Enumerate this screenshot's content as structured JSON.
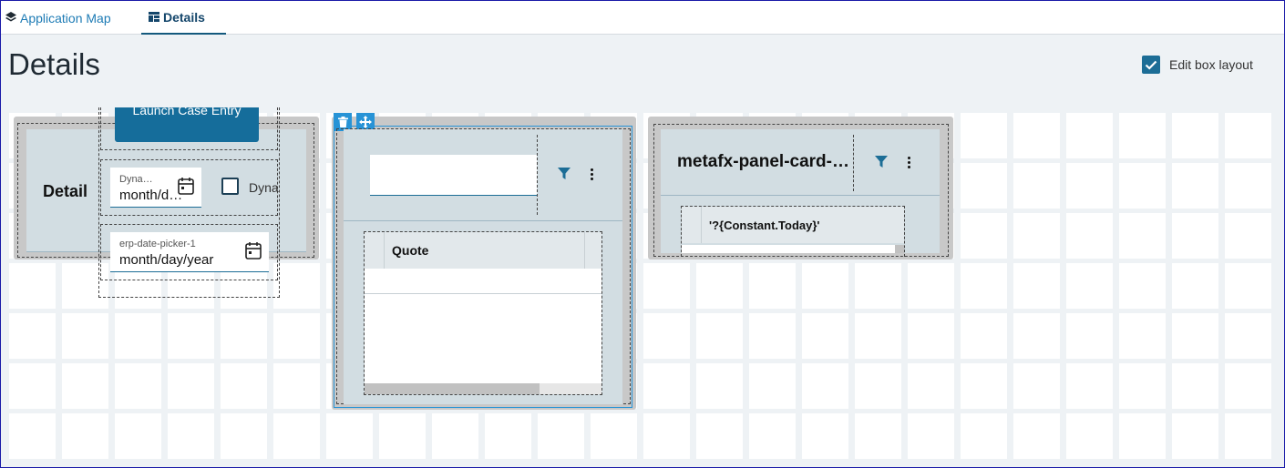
{
  "tabs": {
    "app_map": "Application Map",
    "details": "Details"
  },
  "page": {
    "title": "Details"
  },
  "edit_layout": {
    "label": "Edit box layout",
    "checked": true
  },
  "detail_widget": {
    "title": "Detail",
    "launch_button": "Launch Case Entry",
    "date_picker_1": {
      "label": "Dyna…",
      "placeholder": "month/d…"
    },
    "checkbox_label": "Dyna",
    "date_picker_2": {
      "label": "erp-date-picker-1",
      "placeholder": "month/day/year"
    }
  },
  "table_widget": {
    "column_header": "Quote"
  },
  "card_widget": {
    "title": "metafx-panel-card-…",
    "column_header": "'?{Constant.Today}'"
  },
  "colors": {
    "accent": "#1c6d96",
    "tab_link": "#1d7bb5",
    "tool_button": "#2793d6"
  }
}
